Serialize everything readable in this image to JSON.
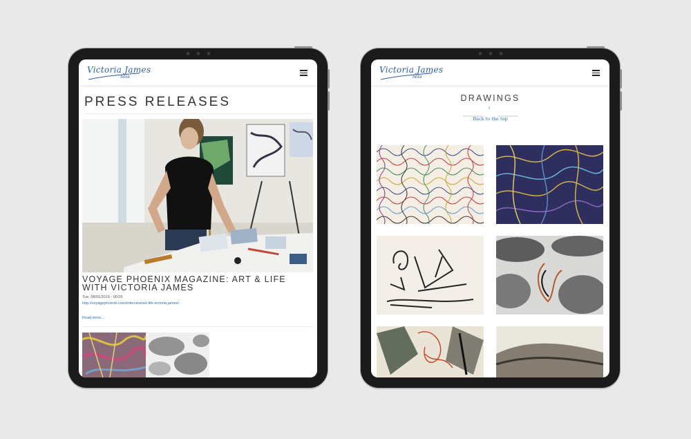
{
  "left_tablet": {
    "logo": {
      "script": "Victoria James",
      "sub": "Artist"
    },
    "page_title": "PRESS RELEASES",
    "article": {
      "title": "VOYAGE PHOENIX MAGAZINE: ART & LIFE WITH VICTORIA JAMES",
      "date": "Tue, 08/01/2019 - 00:05",
      "link": "http://voyagephoenix.com/interview/art-life-victoria-james/",
      "read_more": "Read more..."
    }
  },
  "right_tablet": {
    "logo": {
      "script": "Victoria James",
      "sub": "Artist"
    },
    "page_title": "DRAWINGS",
    "separator_mark": "ǁ",
    "back_to_top": "Back to the top"
  },
  "colors": {
    "accent": "#2f5c9e",
    "link": "#2a6fb3",
    "background": "#e9e9e9",
    "bezel": "#1b1b1b"
  }
}
